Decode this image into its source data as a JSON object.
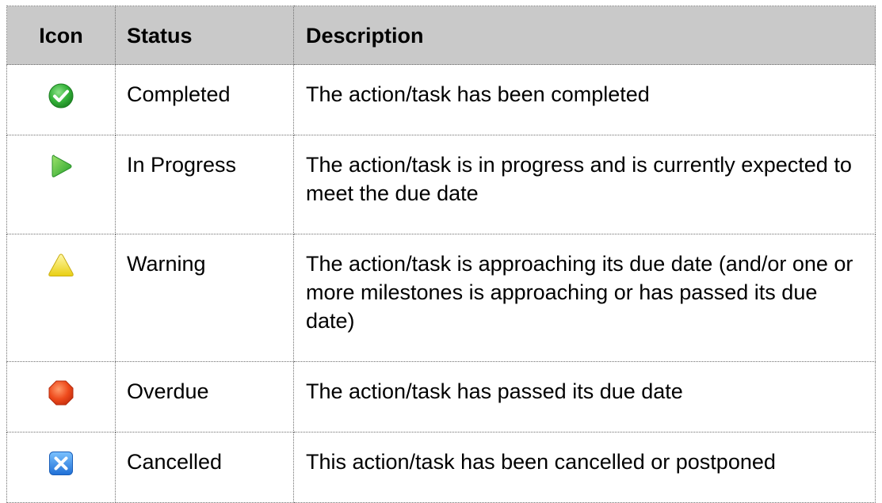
{
  "table": {
    "headers": {
      "icon": "Icon",
      "status": "Status",
      "description": "Description"
    },
    "rows": [
      {
        "icon": "check-circle-icon",
        "icon_color": "#2fa82f",
        "status": "Completed",
        "description": "The action/task has been completed"
      },
      {
        "icon": "play-triangle-icon",
        "icon_color": "#3cba2e",
        "status": "In Progress",
        "description": "The action/task is in progress and is currently expected to meet the due date"
      },
      {
        "icon": "warning-triangle-icon",
        "icon_color": "#f4e23a",
        "status": "Warning",
        "description": "The action/task is approaching its due date (and/or one or more milestones is approaching or has passed its due date)"
      },
      {
        "icon": "stop-octagon-icon",
        "icon_color": "#e8431b",
        "status": "Overdue",
        "description": "The action/task has passed its due date"
      },
      {
        "icon": "x-square-icon",
        "icon_color": "#2f7fe0",
        "status": "Cancelled",
        "description": "This action/task has been cancelled or postponed"
      }
    ],
    "header_background": "#c9c9c9"
  }
}
